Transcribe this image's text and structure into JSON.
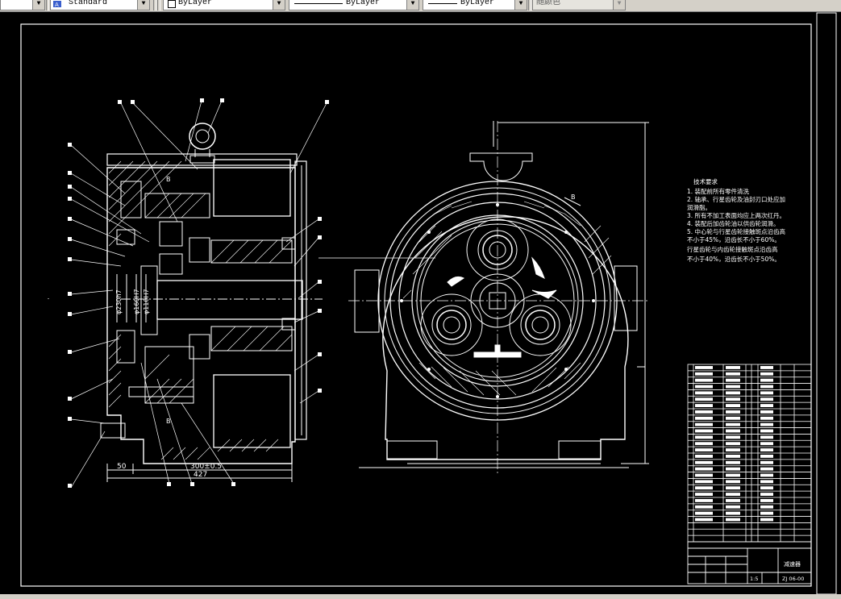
{
  "toolbar": {
    "text_style": "Standard",
    "layer_color": "ByLayer",
    "linetype": "ByLayer",
    "lineweight": "ByLayer",
    "plot_color": "随颜色"
  },
  "drawing": {
    "dimensions": {
      "d_left_offset": "50",
      "d_width_a": "300±0.5",
      "d_width_b": "427",
      "dia_1": "φ230h7",
      "dia_2": "φ160H7",
      "dia_3": "φ110H7"
    },
    "section_labels": [
      "B",
      "B",
      "B"
    ],
    "tech_req": {
      "title": "技术要求",
      "lines": [
        "1. 装配前所有零件清洗",
        "2. 轴承、行星齿轮及油封刃口处应加",
        "   润滑脂。",
        "3. 所有不加工表面均应上两次红丹。",
        "4. 装配后加齿轮油以供齿轮润滑。",
        "5. 中心轮与行星齿轮接触斑点沿齿高",
        "   不小于45%，沿齿长不小于60%。",
        "   行星齿轮与内齿轮接触斑点沿齿高",
        "   不小于40%，沿齿长不小于50%。"
      ]
    },
    "title_block": {
      "name": "减速器",
      "drawing_no": "ZJ 06-00",
      "scale": "1:5"
    }
  }
}
